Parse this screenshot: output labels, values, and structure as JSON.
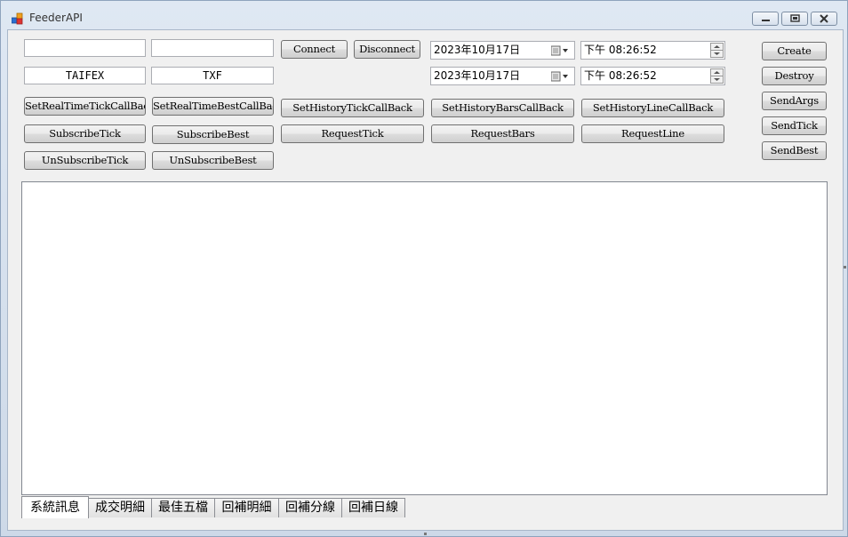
{
  "window": {
    "title": "FeederAPI"
  },
  "inputs": {
    "top_left_1": "",
    "top_left_2": "",
    "exchange": "TAIFEX",
    "symbol": "TXF"
  },
  "buttons": {
    "connect": "Connect",
    "disconnect": "Disconnect",
    "set_realtime_tick_callback": "SetRealTimeTickCallBack",
    "set_realtime_best_callback": "SetRealTimeBestCallBack",
    "set_history_tick_callback": "SetHistoryTickCallBack",
    "set_history_bars_callback": "SetHistoryBarsCallBack",
    "set_history_line_callback": "SetHistoryLineCallBack",
    "subscribe_tick": "SubscribeTick",
    "subscribe_best": "SubscribeBest",
    "request_tick": "RequestTick",
    "request_bars": "RequestBars",
    "request_line": "RequestLine",
    "unsubscribe_tick": "UnSubscribeTick",
    "unsubscribe_best": "UnSubscribeBest",
    "create": "Create",
    "destroy": "Destroy",
    "send_args": "SendArgs",
    "send_tick": "SendTick",
    "send_best": "SendBest"
  },
  "dates": {
    "start_date": "2023年10月17日",
    "end_date": "2023年10月17日",
    "start_time": "下午 08:26:52",
    "end_time": "下午 08:26:52"
  },
  "tabs": [
    "系統訊息",
    "成交明細",
    "最佳五檔",
    "回補明細",
    "回補分線",
    "回補日線"
  ],
  "active_tab": 0
}
